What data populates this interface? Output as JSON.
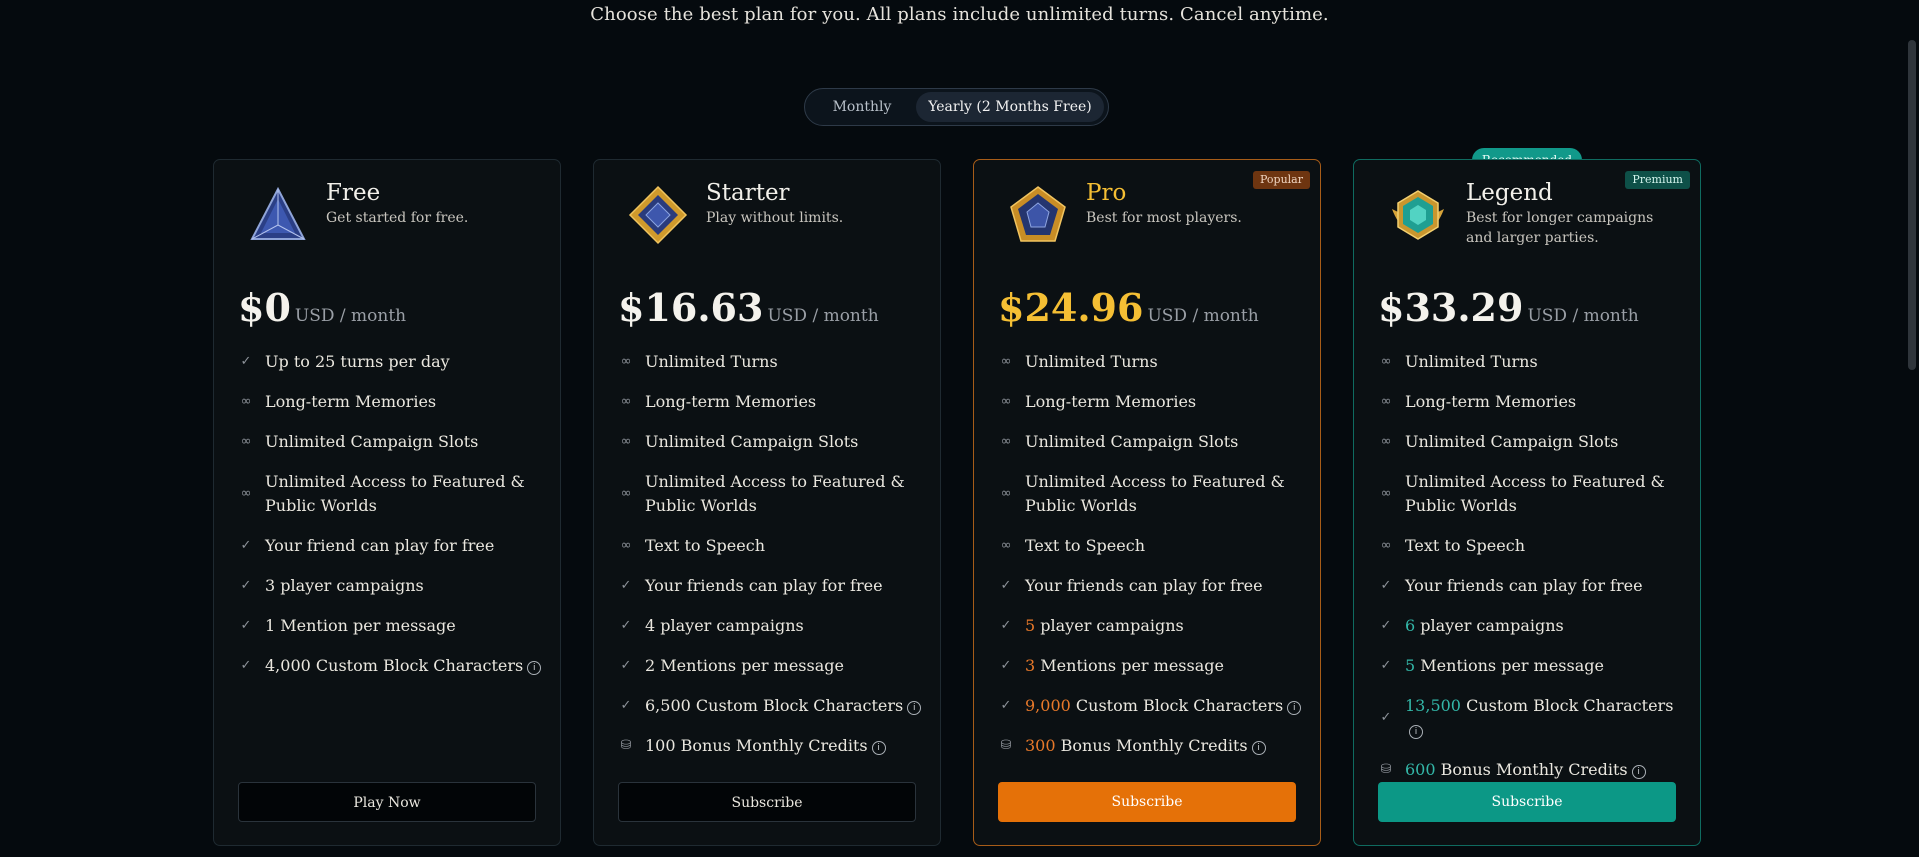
{
  "header": {
    "subtitle": "Choose the best plan for you. All plans include unlimited turns. Cancel anytime."
  },
  "billing_toggle": {
    "monthly_label": "Monthly",
    "yearly_label": "Yearly (2 Months Free)",
    "selected": "yearly"
  },
  "colors": {
    "background": "#050a0e",
    "pro_accent": "#e57108",
    "pro_title": "#f5bf34",
    "legend_accent": "#0c9886"
  },
  "plans": [
    {
      "name": "Free",
      "tagline": "Get started for free.",
      "icon": "triangle-gem-icon",
      "price": "$0",
      "period": "USD / month",
      "features": [
        {
          "icon": "check-icon",
          "text": "Up to 25 turns per day"
        },
        {
          "icon": "infinity-icon",
          "text": "Long-term Memories"
        },
        {
          "icon": "infinity-icon",
          "text": "Unlimited Campaign Slots"
        },
        {
          "icon": "infinity-icon",
          "text": "Unlimited Access to Featured & Public Worlds"
        },
        {
          "icon": "check-icon",
          "text": "Your friend can play for free"
        },
        {
          "icon": "check-icon",
          "text": "3 player campaigns"
        },
        {
          "icon": "check-icon",
          "text": "1 Mention per message"
        },
        {
          "icon": "check-icon",
          "text": "4,000 Custom Block Characters"
        }
      ],
      "cta": "Play Now"
    },
    {
      "name": "Starter",
      "tagline": "Play without limits.",
      "icon": "diamond-gem-icon",
      "price": "$16.63",
      "period": "USD / month",
      "features": [
        {
          "icon": "infinity-icon",
          "text": "Unlimited Turns"
        },
        {
          "icon": "infinity-icon",
          "text": "Long-term Memories"
        },
        {
          "icon": "infinity-icon",
          "text": "Unlimited Campaign Slots"
        },
        {
          "icon": "infinity-icon",
          "text": "Unlimited Access to Featured & Public Worlds"
        },
        {
          "icon": "infinity-icon",
          "text": "Text to Speech"
        },
        {
          "icon": "check-icon",
          "text": "Your friends can play for free"
        },
        {
          "icon": "check-icon",
          "text": "4 player campaigns"
        },
        {
          "icon": "check-icon",
          "text": "2 Mentions per message"
        },
        {
          "icon": "check-icon",
          "text": "6,500 Custom Block Characters"
        },
        {
          "icon": "coins-icon",
          "text": "100 Bonus Monthly Credits"
        }
      ],
      "cta": "Subscribe"
    },
    {
      "name": "Pro",
      "tagline": "Best for most players.",
      "icon": "pentagon-gem-icon",
      "badge": "Popular",
      "price": "$24.96",
      "period": "USD / month",
      "features": [
        {
          "icon": "infinity-icon",
          "text": "Unlimited Turns"
        },
        {
          "icon": "infinity-icon",
          "text": "Long-term Memories"
        },
        {
          "icon": "infinity-icon",
          "text": "Unlimited Campaign Slots"
        },
        {
          "icon": "infinity-icon",
          "text": "Unlimited Access to Featured & Public Worlds"
        },
        {
          "icon": "infinity-icon",
          "text": "Text to Speech"
        },
        {
          "icon": "check-icon",
          "text": "Your friends can play for free"
        },
        {
          "icon": "check-icon",
          "highlight": "5",
          "text": "player campaigns"
        },
        {
          "icon": "check-icon",
          "highlight": "3",
          "text": "Mentions per message"
        },
        {
          "icon": "check-icon",
          "highlight": "9,000",
          "text": "Custom Block Characters"
        },
        {
          "icon": "coins-icon",
          "highlight": "300",
          "text": "Bonus Monthly Credits"
        }
      ],
      "cta": "Subscribe"
    },
    {
      "name": "Legend",
      "tagline": "Best for longer campaigns and larger parties.",
      "icon": "winged-gem-icon",
      "badge": "Premium",
      "recommended": "Recommended",
      "price": "$33.29",
      "period": "USD / month",
      "features": [
        {
          "icon": "infinity-icon",
          "text": "Unlimited Turns"
        },
        {
          "icon": "infinity-icon",
          "text": "Long-term Memories"
        },
        {
          "icon": "infinity-icon",
          "text": "Unlimited Campaign Slots"
        },
        {
          "icon": "infinity-icon",
          "text": "Unlimited Access to Featured & Public Worlds"
        },
        {
          "icon": "infinity-icon",
          "text": "Text to Speech"
        },
        {
          "icon": "check-icon",
          "text": "Your friends can play for free"
        },
        {
          "icon": "check-icon",
          "highlight": "6",
          "text": "player campaigns"
        },
        {
          "icon": "check-icon",
          "highlight": "5",
          "text": "Mentions per message"
        },
        {
          "icon": "check-icon",
          "highlight": "13,500",
          "text": "Custom Block Characters"
        },
        {
          "icon": "coins-icon",
          "highlight": "600",
          "text": "Bonus Monthly Credits"
        }
      ],
      "cta": "Subscribe"
    }
  ]
}
